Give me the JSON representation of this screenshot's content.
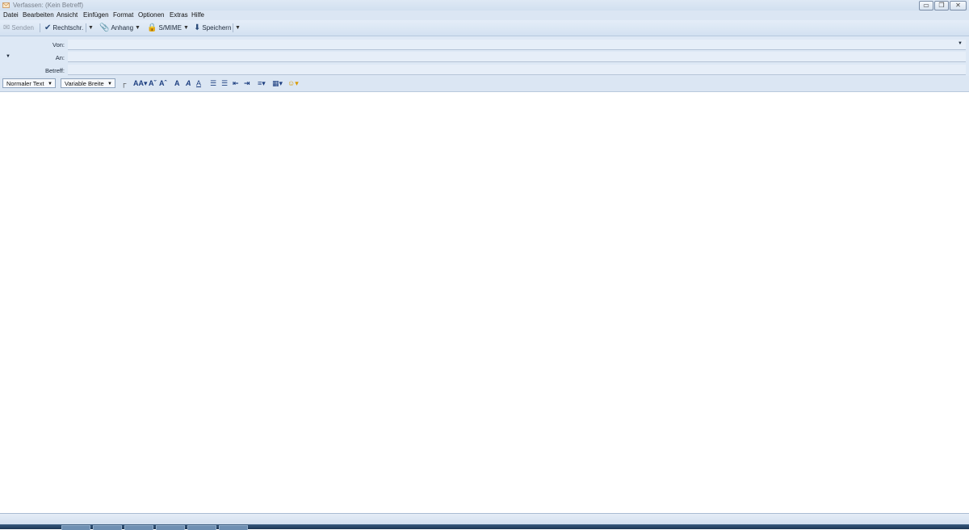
{
  "window": {
    "title": "Verfassen: (Kein Betreff)",
    "controls": {
      "minimize": "▭",
      "restore": "❐",
      "close": "✕"
    }
  },
  "menu": [
    "Datei",
    "Bearbeiten",
    "Ansicht",
    "Einfügen",
    "Format",
    "Optionen",
    "Extras",
    "Hilfe"
  ],
  "toolbar": {
    "send": "Senden",
    "spelling": "Rechtschr.",
    "attach": "Anhang",
    "smime": "S/MIME",
    "save": "Speichern"
  },
  "compose": {
    "from_label": "Von:",
    "to_label": "An:",
    "subject_label": "Betreff:",
    "from_value": "",
    "to_value": "",
    "subject_value": ""
  },
  "format": {
    "paragraph_style": "Normaler Text",
    "font": "Variable Breite",
    "icons": [
      "text-color-icon",
      "smaller-font-icon",
      "larger-font-icon",
      "bold-icon",
      "italic-icon",
      "underline-icon",
      "bullet-list-icon",
      "numbered-list-icon",
      "outdent-icon",
      "indent-icon",
      "align-icon",
      "insert-icon",
      "emoticon-icon"
    ]
  },
  "colors": {
    "toolbar_bg": "#dbe6f3",
    "accent": "#1d3f80",
    "taskbar": "#1c3553"
  }
}
